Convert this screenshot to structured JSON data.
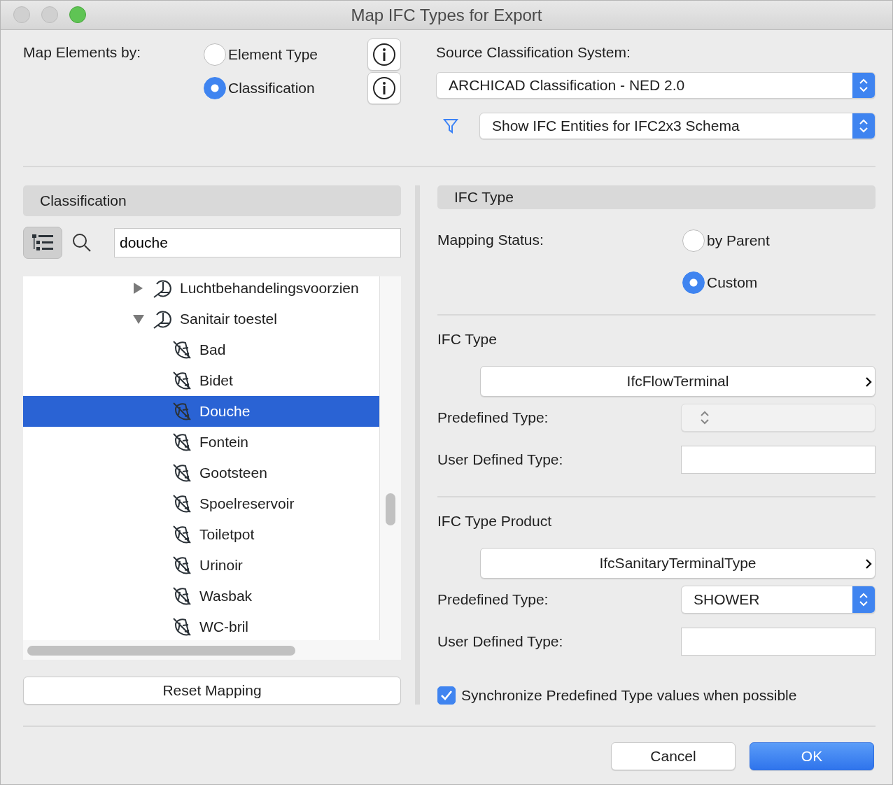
{
  "window": {
    "title": "Map IFC Types for Export"
  },
  "map_by": {
    "label": "Map Elements by:",
    "options": [
      {
        "label": "Element Type",
        "selected": false
      },
      {
        "label": "Classification",
        "selected": true
      }
    ]
  },
  "source": {
    "label": "Source Classification System:",
    "value": "ARCHICAD Classification - NED 2.0"
  },
  "filter": {
    "value": "Show IFC Entities for IFC2x3 Schema"
  },
  "classification_panel": {
    "title": "Classification",
    "search": {
      "value": "douche"
    },
    "tree": [
      {
        "label": "Luchtbehandelingsvoorzien",
        "kind": "group",
        "expanded": false,
        "selected": false
      },
      {
        "label": "Sanitair toestel",
        "kind": "group",
        "expanded": true,
        "selected": false,
        "children": [
          {
            "label": "Bad",
            "kind": "leaf",
            "selected": false
          },
          {
            "label": "Bidet",
            "kind": "leaf",
            "selected": false
          },
          {
            "label": "Douche",
            "kind": "leaf",
            "selected": true
          },
          {
            "label": "Fontein",
            "kind": "leaf",
            "selected": false
          },
          {
            "label": "Gootsteen",
            "kind": "leaf",
            "selected": false
          },
          {
            "label": "Spoelreservoir",
            "kind": "leaf",
            "selected": false
          },
          {
            "label": "Toiletpot",
            "kind": "leaf",
            "selected": false
          },
          {
            "label": "Urinoir",
            "kind": "leaf",
            "selected": false
          },
          {
            "label": "Wasbak",
            "kind": "leaf",
            "selected": false
          },
          {
            "label": "WC-bril",
            "kind": "leaf",
            "selected": false
          }
        ]
      }
    ],
    "reset_button": "Reset Mapping"
  },
  "ifc_panel": {
    "title": "IFC Type",
    "mapping_status": {
      "label": "Mapping Status:",
      "options": [
        {
          "label": "by Parent",
          "selected": false
        },
        {
          "label": "Custom",
          "selected": true
        }
      ]
    },
    "sections": [
      {
        "heading": "IFC Type",
        "value": "IfcFlowTerminal",
        "predefined_label": "Predefined Type:",
        "predefined": {
          "disabled": true
        },
        "user_defined_label": "User Defined Type:"
      },
      {
        "heading": "IFC Type Product",
        "value": "IfcSanitaryTerminalType",
        "predefined_label": "Predefined Type:",
        "predefined": {
          "value": "SHOWER",
          "disabled": false
        },
        "user_defined_label": "User Defined Type:"
      }
    ],
    "sync": {
      "label": "Synchronize Predefined Type values when possible",
      "checked": true
    }
  },
  "buttons": [
    {
      "label": "Cancel",
      "kind": "secondary"
    },
    {
      "label": "OK",
      "kind": "default"
    }
  ]
}
